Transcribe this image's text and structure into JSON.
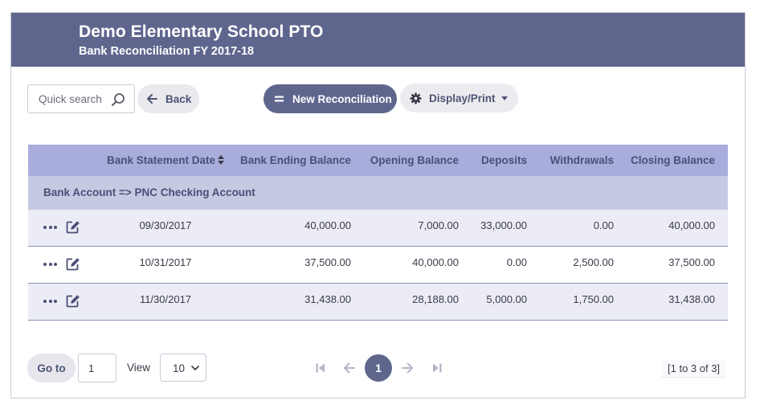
{
  "header": {
    "title": "Demo Elementary School PTO",
    "subtitle": "Bank Reconciliation FY 2017-18"
  },
  "toolbar": {
    "search_placeholder": "Quick search",
    "back_label": "Back",
    "new_label": "New Reconciliation",
    "display_label": "Display/Print"
  },
  "table": {
    "columns": {
      "statement_date": "Bank Statement Date",
      "ending_balance": "Bank Ending Balance",
      "opening_balance": "Opening Balance",
      "deposits": "Deposits",
      "withdrawals": "Withdrawals",
      "closing_balance": "Closing Balance"
    },
    "group_label": "Bank Account => PNC Checking Account",
    "rows": [
      {
        "date": "09/30/2017",
        "ending": "40,000.00",
        "opening": "7,000.00",
        "deposits": "33,000.00",
        "withdrawals": "0.00",
        "closing": "40,000.00"
      },
      {
        "date": "10/31/2017",
        "ending": "37,500.00",
        "opening": "40,000.00",
        "deposits": "0.00",
        "withdrawals": "2,500.00",
        "closing": "37,500.00"
      },
      {
        "date": "11/30/2017",
        "ending": "31,438.00",
        "opening": "28,188.00",
        "deposits": "5,000.00",
        "withdrawals": "1,750.00",
        "closing": "31,438.00"
      }
    ]
  },
  "footer": {
    "goto_label": "Go to",
    "goto_value": "1",
    "view_label": "View",
    "view_value": "10",
    "current_page": "1",
    "range_text": "[1 to 3 of 3]"
  },
  "colors": {
    "header_bg": "#5f668e",
    "table_header_bg": "#a9addb",
    "group_row_bg": "#c6c9e2",
    "alt_row_bg": "#ebecf5"
  }
}
